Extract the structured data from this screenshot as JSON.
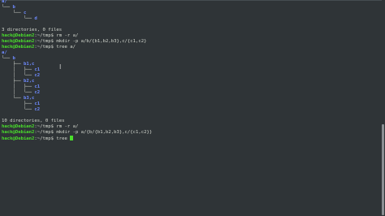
{
  "terminal": {
    "lines": [
      [
        {
          "t": "a/",
          "c": "blue"
        }
      ],
      [
        {
          "t": "└── ",
          "c": "tree"
        },
        {
          "t": "b",
          "c": "blue"
        }
      ],
      [
        {
          "t": "    └── ",
          "c": "tree"
        },
        {
          "t": "c",
          "c": "blue"
        }
      ],
      [
        {
          "t": "        └── ",
          "c": "tree"
        },
        {
          "t": "d",
          "c": "blue"
        }
      ],
      [],
      [
        {
          "t": "3 directories, 0 files",
          "c": "plain"
        }
      ],
      [
        {
          "t": "hack@Debian2",
          "c": "green"
        },
        {
          "t": ":~/tmp$ rm -r a/",
          "c": "plain"
        }
      ],
      [
        {
          "t": "hack@Debian2",
          "c": "green"
        },
        {
          "t": ":~/tmp$ mkdir -p a/b/{b1,b2,b3},c/{c1,c2}",
          "c": "plain"
        }
      ],
      [
        {
          "t": "hack@Debian2",
          "c": "green"
        },
        {
          "t": ":~/tmp$ tree a/",
          "c": "plain"
        }
      ],
      [
        {
          "t": "a/",
          "c": "blue"
        }
      ],
      [
        {
          "t": "└── ",
          "c": "tree"
        },
        {
          "t": "b",
          "c": "blue"
        }
      ],
      [
        {
          "t": "    ├── ",
          "c": "tree"
        },
        {
          "t": "b1,c",
          "c": "blue"
        }
      ],
      [
        {
          "t": "    │   ├── ",
          "c": "tree"
        },
        {
          "t": "c1",
          "c": "blue"
        }
      ],
      [
        {
          "t": "    │   └── ",
          "c": "tree"
        },
        {
          "t": "c2",
          "c": "blue"
        }
      ],
      [
        {
          "t": "    ├── ",
          "c": "tree"
        },
        {
          "t": "b2,c",
          "c": "blue"
        }
      ],
      [
        {
          "t": "    │   ├── ",
          "c": "tree"
        },
        {
          "t": "c1",
          "c": "blue"
        }
      ],
      [
        {
          "t": "    │   └── ",
          "c": "tree"
        },
        {
          "t": "c2",
          "c": "blue"
        }
      ],
      [
        {
          "t": "    └── ",
          "c": "tree"
        },
        {
          "t": "b3,c",
          "c": "blue"
        }
      ],
      [
        {
          "t": "        ├── ",
          "c": "tree"
        },
        {
          "t": "c1",
          "c": "blue"
        }
      ],
      [
        {
          "t": "        └── ",
          "c": "tree"
        },
        {
          "t": "c2",
          "c": "blue"
        }
      ],
      [],
      [
        {
          "t": "10 directories, 0 files",
          "c": "plain"
        }
      ],
      [
        {
          "t": "hack@Debian2",
          "c": "green"
        },
        {
          "t": ":~/tmp$ rm -r a/",
          "c": "plain"
        }
      ],
      [
        {
          "t": "hack@Debian2",
          "c": "green"
        },
        {
          "t": ":~/tmp$ mkdir -p a/{b/{b1,b2,b3},c/{c1,c2}}",
          "c": "plain"
        }
      ],
      [
        {
          "t": "hack@Debian2",
          "c": "green"
        },
        {
          "t": ":~/tmp$ tree ",
          "c": "plain"
        },
        {
          "cursor": true
        }
      ]
    ]
  },
  "icons": {
    "mouse_cursor": "text-ibeam-icon",
    "mouse_cursor_glyph": "I"
  },
  "colors": {
    "background": "#2f3437",
    "prompt": "#4ade2c",
    "directory": "#6f8bff",
    "text": "#d3d7cf"
  }
}
